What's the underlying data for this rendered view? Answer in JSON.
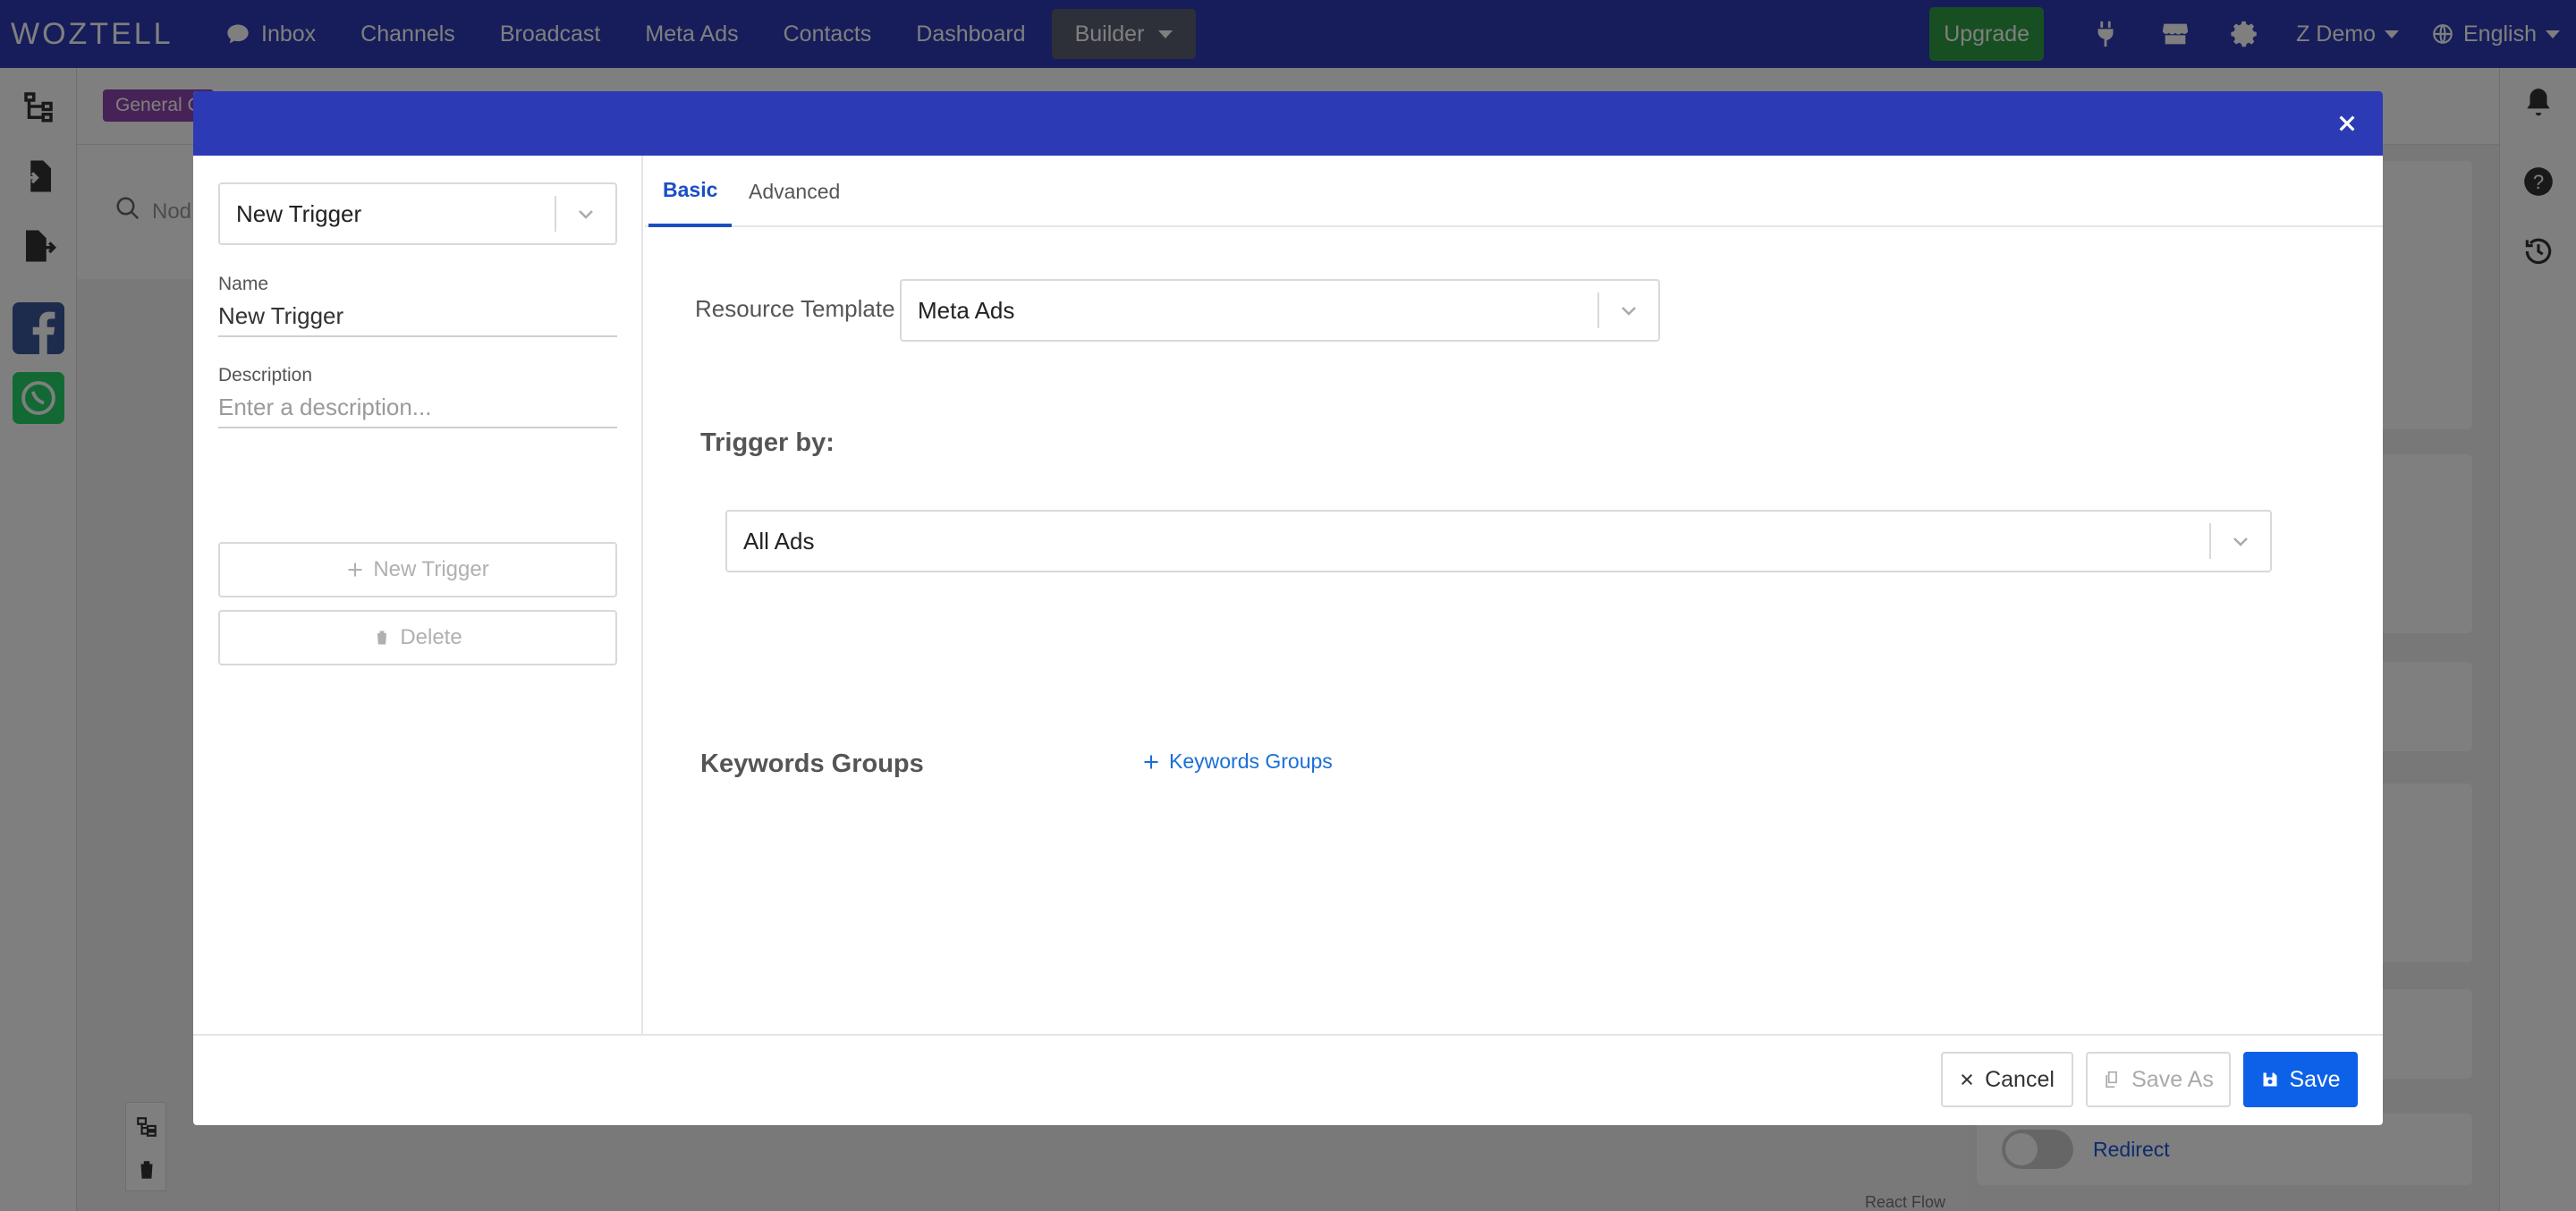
{
  "app": {
    "brand": "WOZTELL",
    "nav": [
      {
        "label": "Inbox",
        "icon": "chat-bubble-icon"
      },
      {
        "label": "Channels"
      },
      {
        "label": "Broadcast"
      },
      {
        "label": "Meta Ads"
      },
      {
        "label": "Contacts"
      },
      {
        "label": "Dashboard"
      }
    ],
    "builder_label": "Builder",
    "upgrade_label": "Upgrade",
    "user_label": "Z Demo",
    "language_label": "English"
  },
  "background": {
    "general_badge": "General C",
    "node_search_placeholder": "Nod",
    "redirect_label": "Redirect",
    "reactflow_label": "React Flow"
  },
  "modal": {
    "trigger_select_value": "New Trigger",
    "name_label": "Name",
    "name_value": "New Trigger",
    "description_label": "Description",
    "description_placeholder": "Enter a description...",
    "new_trigger_button": "New Trigger",
    "delete_button": "Delete",
    "tabs": [
      {
        "label": "Basic",
        "active": true
      },
      {
        "label": "Advanced",
        "active": false
      }
    ],
    "resource_template_label": "Resource Template",
    "resource_template_value": "Meta Ads",
    "trigger_by_title": "Trigger by:",
    "trigger_by_value": "All Ads",
    "keywords_groups_title": "Keywords Groups",
    "keywords_groups_add": "Keywords Groups",
    "cancel_button": "Cancel",
    "save_as_button": "Save As",
    "save_button": "Save"
  },
  "colors": {
    "header_blue": "#2c3bb5",
    "primary_blue": "#0d61e8",
    "link_blue": "#1a6fd6",
    "upgrade_green": "#2e9e44",
    "builder_gray": "#5a6173",
    "badge_purple": "#8e44ad"
  }
}
